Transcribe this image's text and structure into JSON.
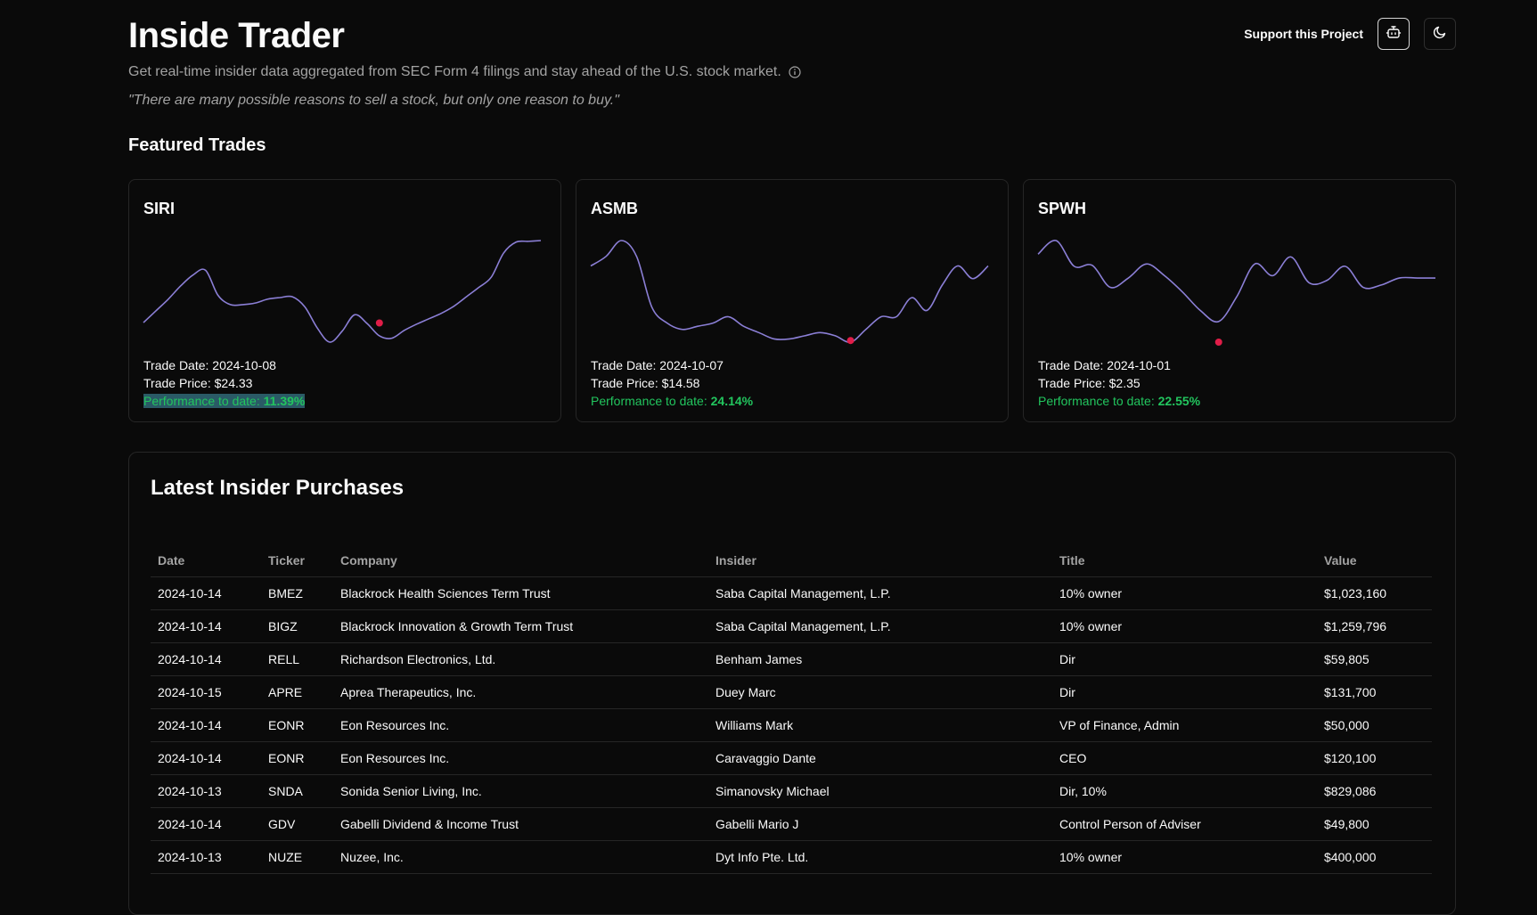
{
  "header": {
    "title": "Inside Trader",
    "subtitle": "Get real-time insider data aggregated from SEC Form 4 filings and stay ahead of the U.S. stock market.",
    "quote": "\"There are many possible reasons to sell a stock, but only one reason to buy.\"",
    "support_label": "Support this Project",
    "icons": {
      "info": "info-circle-icon",
      "bot": "bot-icon",
      "theme": "moon-icon"
    }
  },
  "featured": {
    "title": "Featured Trades",
    "cards": [
      {
        "ticker": "SIRI",
        "trade_date": "Trade Date: 2024-10-08",
        "trade_price": "Trade Price: $24.33",
        "perf_label": "Performance to date: ",
        "perf_value": "11.39%",
        "prices": [
          27.5,
          29.0,
          30.5,
          32.2,
          33.6,
          34.2,
          31.0,
          29.8,
          29.8,
          30.0,
          30.5,
          30.7,
          30.8,
          29.5,
          26.8,
          25.0,
          26.4,
          28.5,
          27.4,
          25.8,
          25.5,
          26.5,
          27.3,
          28.0,
          28.7,
          29.6,
          30.8,
          32.0,
          33.3,
          36.4,
          37.8,
          37.9,
          38.0
        ],
        "trade_index": 19,
        "trade_value": 27.45
      },
      {
        "ticker": "ASMB",
        "trade_date": "Trade Date: 2024-10-07",
        "trade_price": "Trade Price: $14.58",
        "perf_label": "Performance to date: ",
        "perf_value": "24.14%",
        "prices": [
          16.6,
          16.9,
          17.4,
          16.9,
          15.3,
          14.8,
          14.6,
          14.7,
          14.8,
          15.0,
          14.7,
          14.5,
          14.3,
          14.3,
          14.4,
          14.5,
          14.4,
          14.2,
          14.6,
          15.0,
          15.0,
          15.6,
          15.2,
          16.0,
          16.6,
          16.2,
          16.6
        ],
        "trade_index": 17,
        "trade_value": 14.25
      },
      {
        "ticker": "SPWH",
        "trade_date": "Trade Date: 2024-10-01",
        "trade_price": "Trade Price: $2.35",
        "perf_label": "Performance to date: ",
        "perf_value": "22.55%",
        "prices": [
          3.66,
          3.95,
          3.4,
          3.42,
          2.95,
          3.15,
          3.45,
          3.2,
          2.85,
          2.45,
          2.22,
          2.75,
          3.45,
          3.2,
          3.6,
          3.05,
          3.1,
          3.4,
          2.95,
          3.0,
          3.15,
          3.15,
          3.15
        ],
        "trade_index": 10,
        "trade_value": 1.78
      }
    ]
  },
  "purchases": {
    "title": "Latest Insider Purchases",
    "columns": [
      "Date",
      "Ticker",
      "Company",
      "Insider",
      "Title",
      "Value"
    ],
    "rows": [
      [
        "2024-10-14",
        "BMEZ",
        "Blackrock Health Sciences Term Trust",
        "Saba Capital Management, L.P.",
        "10% owner",
        "$1,023,160"
      ],
      [
        "2024-10-14",
        "BIGZ",
        "Blackrock Innovation & Growth Term Trust",
        "Saba Capital Management, L.P.",
        "10% owner",
        "$1,259,796"
      ],
      [
        "2024-10-14",
        "RELL",
        "Richardson Electronics, Ltd.",
        "Benham James",
        "Dir",
        "$59,805"
      ],
      [
        "2024-10-15",
        "APRE",
        "Aprea Therapeutics, Inc.",
        "Duey Marc",
        "Dir",
        "$131,700"
      ],
      [
        "2024-10-14",
        "EONR",
        "Eon Resources Inc.",
        "Williams Mark",
        "VP of Finance, Admin",
        "$50,000"
      ],
      [
        "2024-10-14",
        "EONR",
        "Eon Resources Inc.",
        "Caravaggio Dante",
        "CEO",
        "$120,100"
      ],
      [
        "2024-10-13",
        "SNDA",
        "Sonida Senior Living, Inc.",
        "Simanovsky Michael",
        "Dir, 10%",
        "$829,086"
      ],
      [
        "2024-10-14",
        "GDV",
        "Gabelli Dividend & Income Trust",
        "Gabelli Mario J",
        "Control Person of Adviser",
        "$49,800"
      ],
      [
        "2024-10-13",
        "NUZE",
        "Nuzee, Inc.",
        "Dyt Info Pte. Ltd.",
        "10% owner",
        "$400,000"
      ]
    ]
  },
  "colors": {
    "line": "#8b7fd6",
    "marker": "#e11d48",
    "perf": "#22c55e",
    "background": "#0a0a0a",
    "border": "#262626"
  }
}
